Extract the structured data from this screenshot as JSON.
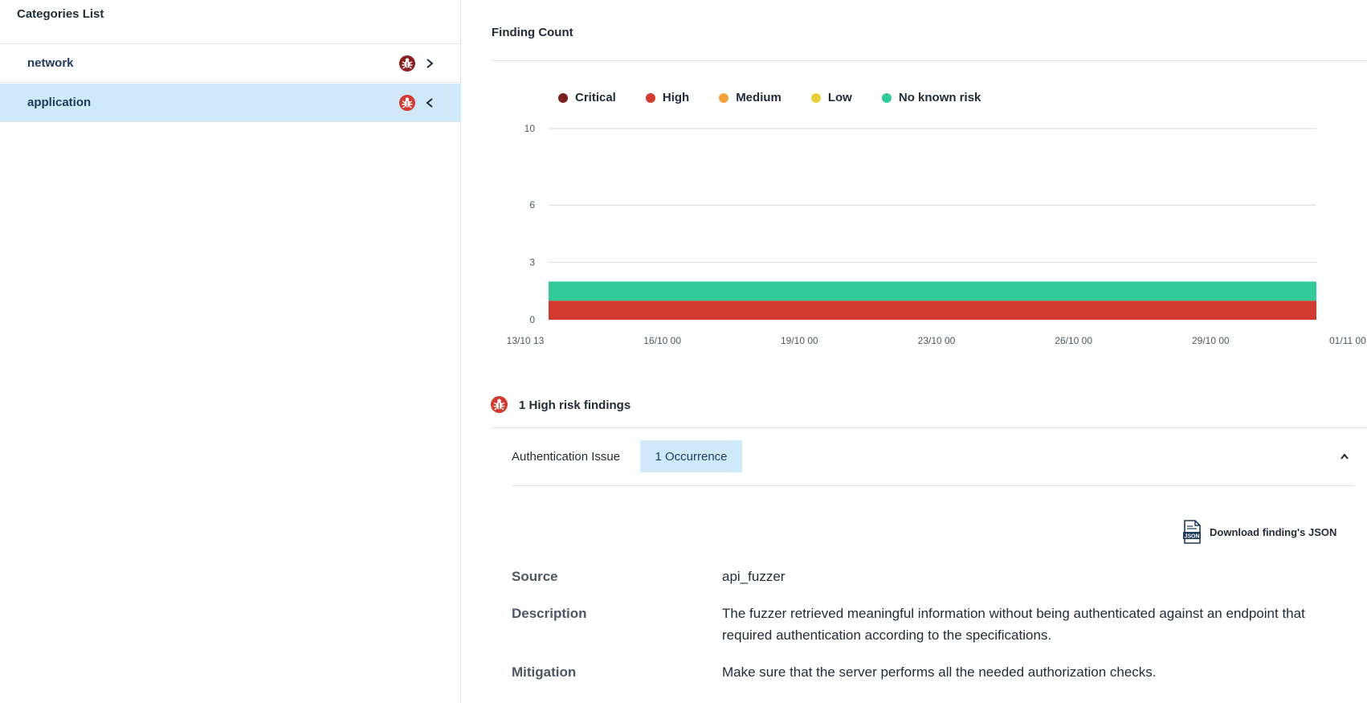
{
  "sidebar": {
    "title": "Categories List",
    "items": [
      {
        "label": "network",
        "badge_color": "#8b1e1e",
        "selected": false,
        "chevron": "chevron-right"
      },
      {
        "label": "application",
        "badge_color": "#d23a2f",
        "selected": true,
        "chevron": "chevron-left"
      }
    ]
  },
  "finding_count": {
    "title": "Finding Count"
  },
  "chart_data": {
    "type": "area",
    "title": "",
    "xlabel": "",
    "ylabel": "",
    "x_ticks": [
      "13/10 13",
      "16/10 00",
      "19/10 00",
      "23/10 00",
      "26/10 00",
      "29/10 00",
      "01/11 00"
    ],
    "y_ticks": [
      0,
      3,
      6,
      10
    ],
    "ylim": [
      0,
      10
    ],
    "grid": true,
    "legend_position": "top-left",
    "stacked": true,
    "series": [
      {
        "name": "Critical",
        "color": "#7a1f1f",
        "values": [
          0,
          0,
          0,
          0,
          0,
          0,
          0
        ]
      },
      {
        "name": "High",
        "color": "#d23a2f",
        "values": [
          1,
          1,
          1,
          1,
          1,
          1,
          1
        ]
      },
      {
        "name": "Medium",
        "color": "#f0a23c",
        "values": [
          0,
          0,
          0,
          0,
          0,
          0,
          0
        ]
      },
      {
        "name": "Low",
        "color": "#e8cd3a",
        "values": [
          0,
          0,
          0,
          0,
          0,
          0,
          0
        ]
      },
      {
        "name": "No known risk",
        "color": "#34c99a",
        "values": [
          1,
          1,
          1,
          1,
          1,
          1,
          1
        ]
      }
    ]
  },
  "findings": {
    "risk_title": "1 High risk findings",
    "risk_icon_color": "#d23a2f",
    "issue": {
      "name": "Authentication Issue",
      "occurrence": "1 Occurrence"
    },
    "download_label": "Download finding's JSON",
    "json_icon_text": "JSON",
    "details": [
      {
        "label": "Source",
        "value": "api_fuzzer"
      },
      {
        "label": "Description",
        "value": "The fuzzer retrieved meaningful information without being authenticated against an endpoint that required authentication according to the specifications."
      },
      {
        "label": "Mitigation",
        "value": "Make sure that the server performs all the needed authorization checks."
      }
    ]
  }
}
